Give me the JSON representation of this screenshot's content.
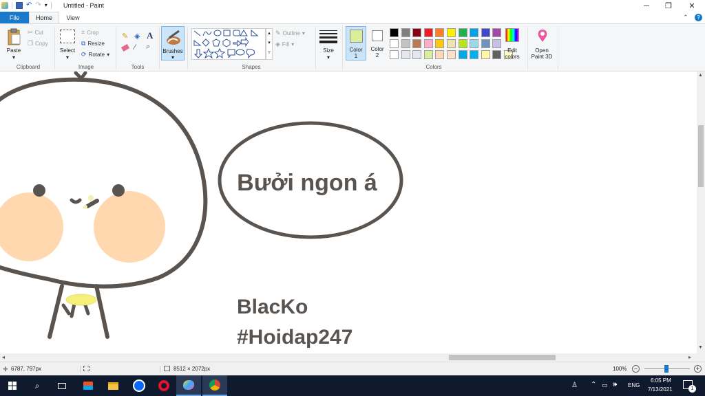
{
  "window": {
    "title": "Untitled - Paint",
    "tabs": {
      "file": "File",
      "home": "Home",
      "view": "View"
    }
  },
  "ribbon": {
    "clipboard": {
      "label": "Clipboard",
      "paste": "Paste",
      "cut": "Cut",
      "copy": "Copy"
    },
    "image": {
      "label": "Image",
      "select": "Select",
      "crop": "Crop",
      "resize": "Resize",
      "rotate": "Rotate"
    },
    "tools": {
      "label": "Tools"
    },
    "brushes": {
      "label": "Brushes"
    },
    "shapes": {
      "label": "Shapes",
      "outline": "Outline",
      "fill": "Fill"
    },
    "size": {
      "label": "Size"
    },
    "colors": {
      "label": "Colors",
      "color1": "Color\n1",
      "color2": "Color\n2",
      "color1_value": "#d8ee9a",
      "color2_value": "#ffffff",
      "edit_colors": "Edit\ncolors",
      "open_paint3d": "Open\nPaint 3D",
      "palette_row1": [
        "#000000",
        "#7f7f7f",
        "#880015",
        "#ed1c24",
        "#ff7f27",
        "#fff200",
        "#22b14c",
        "#00a2e8",
        "#3f48cc",
        "#a349a4"
      ],
      "palette_row2": [
        "#ffffff",
        "#c3c3c3",
        "#b97a57",
        "#ffaec9",
        "#ffc90e",
        "#efe4b0",
        "#b5e61d",
        "#99d9ea",
        "#7092be",
        "#c8bfe7"
      ],
      "palette_row3": [
        "#ffffff",
        "#e6e6f0",
        "#e6e6f0",
        "#d8ee9a",
        "#ffd8b8",
        "#ffe0c8",
        "#00a8e8",
        "#00b0f0",
        "#fff6a8",
        "#606060",
        "#fffcc8"
      ]
    }
  },
  "canvas": {
    "speech_text": "Bưởi ngon á",
    "signature_line1": "BlacKo",
    "signature_line2": "#Hoidap247"
  },
  "status": {
    "cursor_pos": "6787, 797px",
    "image_size": "8512 × 2072px",
    "zoom": "100%"
  },
  "taskbar": {
    "lang": "ENG",
    "time": "6:05 PM",
    "date": "7/13/2021",
    "notification_count": "1"
  }
}
